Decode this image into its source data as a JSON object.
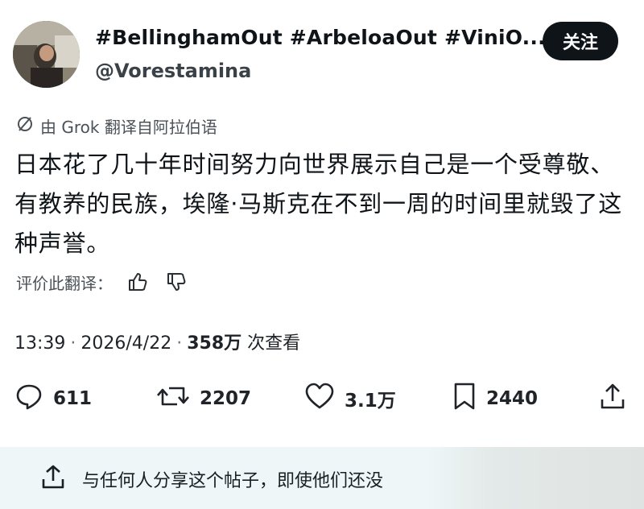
{
  "author": {
    "name": "#BellinghamOut #ArbeloaOut #ViniO...",
    "handle": "@Vorestamina"
  },
  "follow_label": "关注",
  "translation": {
    "note": "由 Grok 翻译自阿拉伯语",
    "rate_label": "评价此翻译："
  },
  "post": {
    "text": "日本花了几十年时间努力向世界展示自己是一个受尊敬、有教养的民族，埃隆·马斯克在不到一周的时间里就毁了这种声誉。"
  },
  "meta": {
    "time": "13:39",
    "date": "2026/4/22",
    "views": "358万",
    "views_suffix": "次查看"
  },
  "actions": {
    "replies": "611",
    "reposts": "2207",
    "likes": "3.1万",
    "bookmarks": "2440"
  },
  "share_bar": {
    "text": "与任何人分享这个帖子，即使他们还没"
  },
  "icons": [
    "avatar",
    "grok-icon",
    "thumbs-up-icon",
    "thumbs-down-icon",
    "reply-icon",
    "repost-icon",
    "like-icon",
    "bookmark-icon",
    "share-icon"
  ],
  "colors": {
    "text": "#0f1419",
    "follow_bg": "#0f1419",
    "share_bar_bg": "#eef6f8"
  }
}
